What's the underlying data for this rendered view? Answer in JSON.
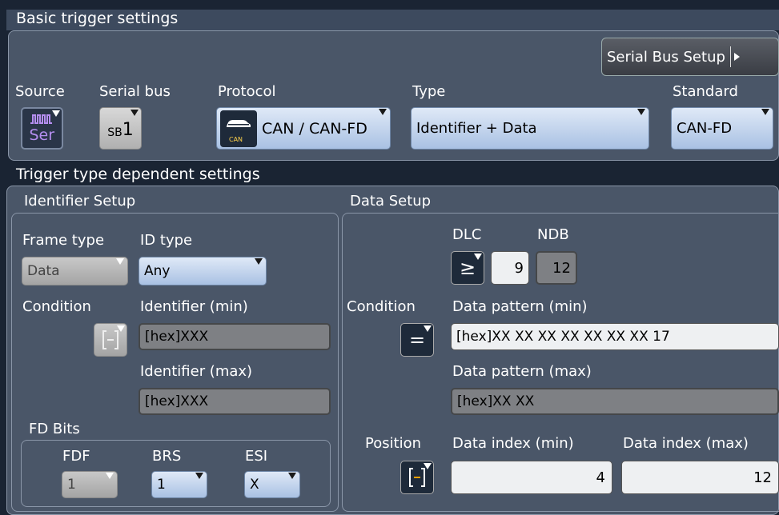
{
  "basic": {
    "title": "Basic trigger settings",
    "serial_bus_setup": "Serial Bus Setup",
    "source_label": "Source",
    "source_value": "Ser",
    "serial_bus_label": "Serial bus",
    "serial_bus_prefix": "SB",
    "serial_bus_num": "1",
    "protocol_label": "Protocol",
    "protocol_value": "CAN / CAN-FD",
    "protocol_icon_text": "CAN",
    "type_label": "Type",
    "type_value": "Identifier + Data",
    "standard_label": "Standard",
    "standard_value": "CAN-FD"
  },
  "dep": {
    "title": "Trigger type dependent settings",
    "ident": {
      "title": "Identifier Setup",
      "frame_type_label": "Frame type",
      "frame_type_value": "Data",
      "id_type_label": "ID type",
      "id_type_value": "Any",
      "condition_label": "Condition",
      "id_min_label": "Identifier (min)",
      "id_min_value": "[hex]XXX",
      "id_max_label": "Identifier (max)",
      "id_max_value": "[hex]XXX"
    },
    "fd": {
      "title": "FD Bits",
      "fdf_label": "FDF",
      "fdf_value": "1",
      "brs_label": "BRS",
      "brs_value": "1",
      "esi_label": "ESI",
      "esi_value": "X"
    },
    "data": {
      "title": "Data Setup",
      "dlc_label": "DLC",
      "dlc_op": "≥",
      "dlc_value": "9",
      "ndb_label": "NDB",
      "ndb_value": "12",
      "condition_label": "Condition",
      "condition_op": "=",
      "pat_min_label": "Data pattern (min)",
      "pat_min_value": "[hex]XX XX XX XX XX XX XX 17",
      "pat_max_label": "Data pattern (max)",
      "pat_max_value": "[hex]XX XX",
      "position_label": "Position",
      "idx_min_label": "Data index (min)",
      "idx_min_value": "4",
      "idx_max_label": "Data index (max)",
      "idx_max_value": "12"
    }
  },
  "colors": {
    "background": "#1a2433",
    "panel": "#4a5668",
    "field_blue": "#a9c1e3",
    "field_gray": "#a4a4a4"
  }
}
